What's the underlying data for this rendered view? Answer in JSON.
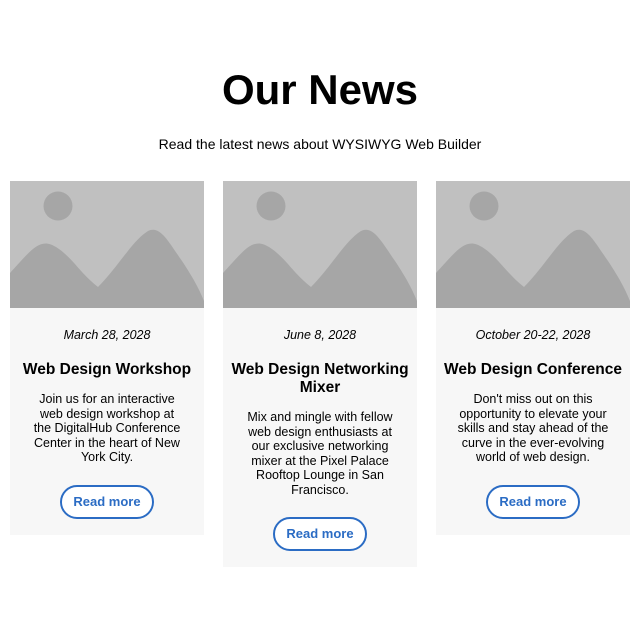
{
  "header": {
    "title": "Our News",
    "subtitle": "Read the latest news about WYSIWYG Web Builder"
  },
  "colors": {
    "accent": "#2b6cc4",
    "card_background": "#f7f7f7",
    "placeholder_sky": "#c0c0c0",
    "placeholder_shape": "#a6a6a6"
  },
  "cards": [
    {
      "image_icon": "image-placeholder-icon",
      "date": "March 28, 2028",
      "title": "Web Design Workshop",
      "text": "Join us for an interactive web design workshop at the DigitalHub Conference Center in the heart of New York City.",
      "button_label": "Read more"
    },
    {
      "image_icon": "image-placeholder-icon",
      "date": "June 8, 2028",
      "title": "Web Design Networking Mixer",
      "text": "Mix and mingle with fellow web design enthusiasts at our exclusive networking mixer at the Pixel Palace Rooftop Lounge in San Francisco.",
      "button_label": "Read more"
    },
    {
      "image_icon": "image-placeholder-icon",
      "date": "October 20-22, 2028",
      "title": "Web Design Conference",
      "text": "Don't miss out on this opportunity to elevate your skills and stay ahead of the curve in the ever-evolving world of web design.",
      "button_label": "Read more"
    }
  ]
}
